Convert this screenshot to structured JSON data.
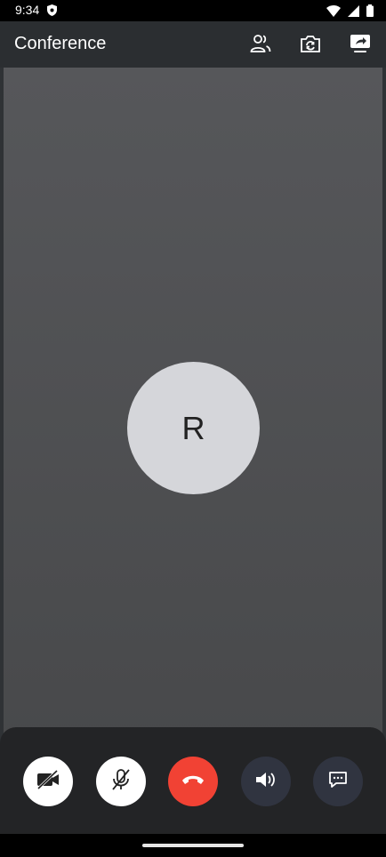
{
  "status_bar": {
    "time": "9:34"
  },
  "app_bar": {
    "title": "Conference"
  },
  "participant": {
    "initial": "R"
  },
  "icons": {
    "status": [
      "shield-icon",
      "wifi-icon",
      "cellular-icon",
      "battery-icon"
    ],
    "app_actions": [
      "participants-icon",
      "switch-camera-icon",
      "screen-share-icon"
    ],
    "controls": [
      "video-off-icon",
      "mic-off-icon",
      "hang-up-icon",
      "speaker-icon",
      "chat-icon"
    ]
  },
  "colors": {
    "end_call": "#f14234",
    "app_bar": "#2b2e31",
    "avatar": "#d5d6da"
  }
}
